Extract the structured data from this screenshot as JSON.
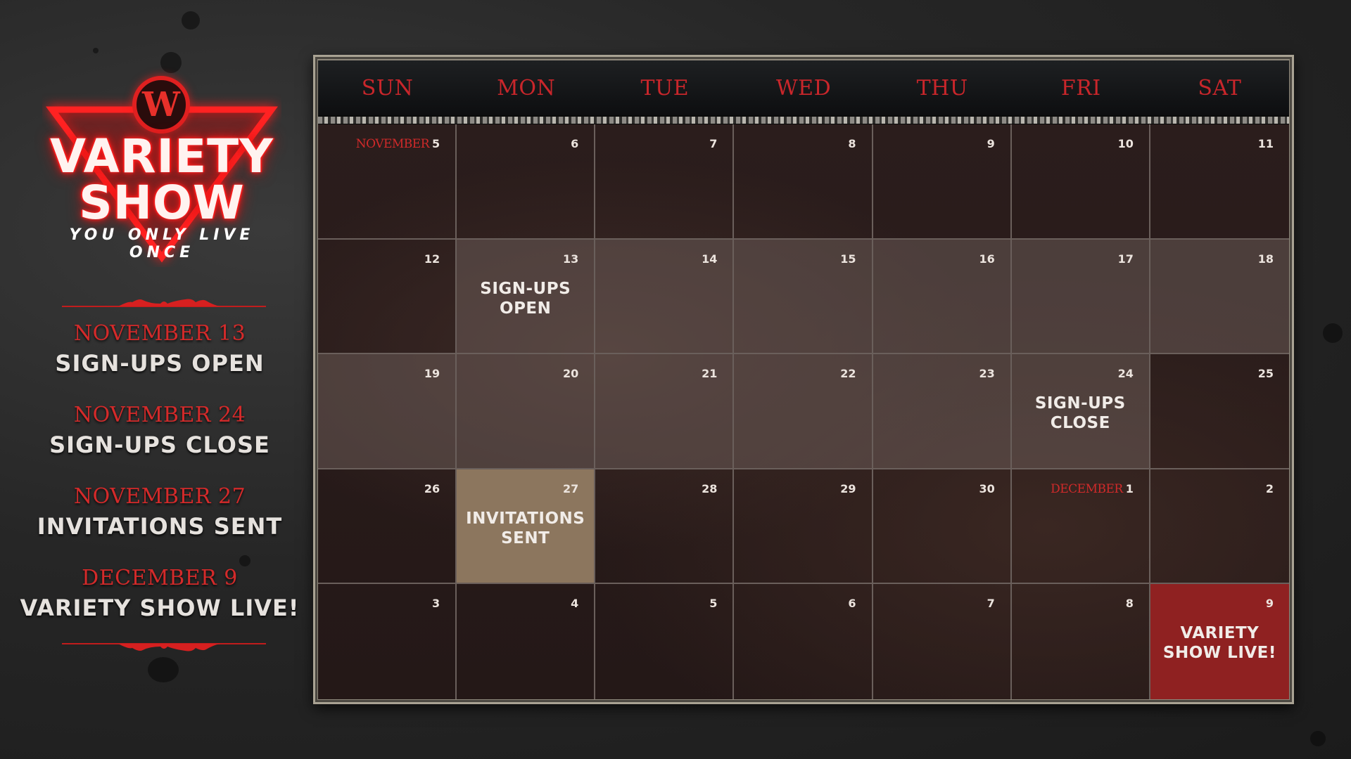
{
  "logo": {
    "badge_letter": "W",
    "title_line1": "VARIETY",
    "title_line2": "SHOW",
    "tagline": "YOU ONLY LIVE ONCE",
    "accent_color": "#e02020"
  },
  "milestones": [
    {
      "date": "NOVEMBER 13",
      "label": "SIGN-UPS OPEN"
    },
    {
      "date": "NOVEMBER 24",
      "label": "SIGN-UPS CLOSE"
    },
    {
      "date": "NOVEMBER 27",
      "label": "INVITATIONS SENT"
    },
    {
      "date": "DECEMBER 9",
      "label": "VARIETY SHOW LIVE!"
    }
  ],
  "calendar": {
    "day_names": [
      "SUN",
      "MON",
      "TUE",
      "WED",
      "THU",
      "FRI",
      "SAT"
    ],
    "colors": {
      "header_text": "#c9262b",
      "highlight_signup_window": "#5a4b47",
      "invitations": "#8c765e",
      "live": "#8f2121"
    },
    "weeks": [
      [
        {
          "day": "5",
          "month": "NOVEMBER"
        },
        {
          "day": "6"
        },
        {
          "day": "7"
        },
        {
          "day": "8"
        },
        {
          "day": "9"
        },
        {
          "day": "10"
        },
        {
          "day": "11"
        }
      ],
      [
        {
          "day": "12"
        },
        {
          "day": "13",
          "event": "SIGN-UPS\nOPEN",
          "style": "hl"
        },
        {
          "day": "14",
          "style": "hl"
        },
        {
          "day": "15",
          "style": "hl"
        },
        {
          "day": "16",
          "style": "hl"
        },
        {
          "day": "17",
          "style": "hl"
        },
        {
          "day": "18",
          "style": "hl"
        }
      ],
      [
        {
          "day": "19",
          "style": "hl"
        },
        {
          "day": "20",
          "style": "hl"
        },
        {
          "day": "21",
          "style": "hl"
        },
        {
          "day": "22",
          "style": "hl"
        },
        {
          "day": "23",
          "style": "hl"
        },
        {
          "day": "24",
          "event": "SIGN-UPS\nCLOSE",
          "style": "hl"
        },
        {
          "day": "25"
        }
      ],
      [
        {
          "day": "26"
        },
        {
          "day": "27",
          "event": "INVITATIONS\nSENT",
          "style": "invite"
        },
        {
          "day": "28"
        },
        {
          "day": "29"
        },
        {
          "day": "30"
        },
        {
          "day": "1",
          "month": "DECEMBER"
        },
        {
          "day": "2"
        }
      ],
      [
        {
          "day": "3"
        },
        {
          "day": "4"
        },
        {
          "day": "5"
        },
        {
          "day": "6"
        },
        {
          "day": "7"
        },
        {
          "day": "8"
        },
        {
          "day": "9",
          "event": "VARIETY\nSHOW LIVE!",
          "style": "live"
        }
      ]
    ]
  }
}
